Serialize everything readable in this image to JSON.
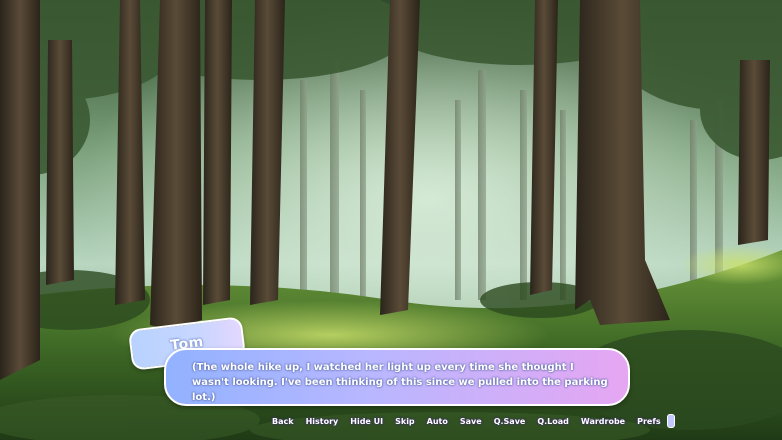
{
  "dialogue": {
    "speaker": "Tom",
    "text": "(The whole hike up, I watched her light up every time she thought I wasn't looking. I've been thinking of this since we pulled into the parking lot.)"
  },
  "quick_menu": {
    "items": [
      "Back",
      "History",
      "Hide UI",
      "Skip",
      "Auto",
      "Save",
      "Q.Save",
      "Q.Load",
      "Wardrobe",
      "Prefs"
    ]
  },
  "colors": {
    "textbox_left": "#92b2ff",
    "textbox_right": "#e6a6f2",
    "namebox": "#c7d6ff"
  }
}
